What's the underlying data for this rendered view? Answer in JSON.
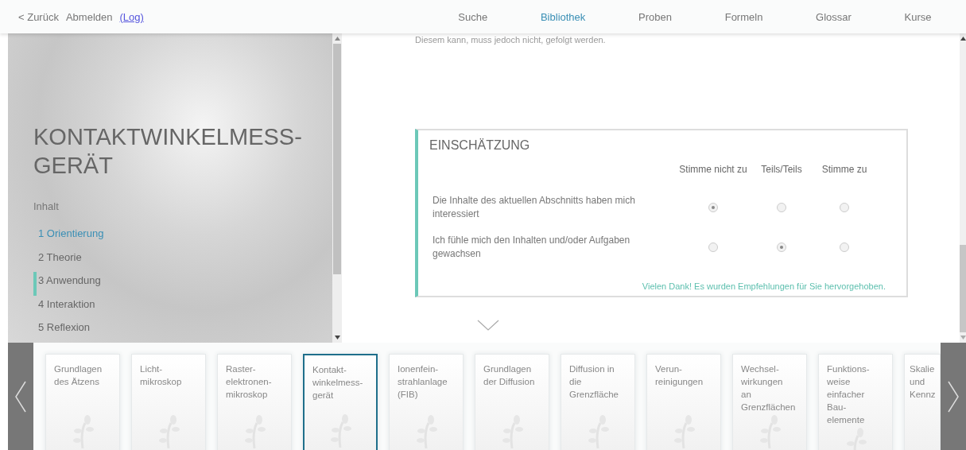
{
  "header": {
    "back": "< Zurück",
    "logout": "Abmelden",
    "log_link": "(Log)",
    "nav": [
      {
        "label": "Suche",
        "selected": false
      },
      {
        "label": "Bibliothek",
        "selected": true
      },
      {
        "label": "Proben",
        "selected": false
      },
      {
        "label": "Formeln",
        "selected": false
      },
      {
        "label": "Glossar",
        "selected": false
      },
      {
        "label": "Kurse",
        "selected": false
      }
    ]
  },
  "sidebar": {
    "title": "KONTAKTWINKELMESS-GERÄT",
    "contents_label": "Inhalt",
    "items": [
      {
        "label": "1 Orientierung",
        "selected": true,
        "marked": false
      },
      {
        "label": "2 Theorie",
        "selected": false,
        "marked": false
      },
      {
        "label": "3 Anwendung",
        "selected": false,
        "marked": true
      },
      {
        "label": "4 Interaktion",
        "selected": false,
        "marked": false
      },
      {
        "label": "5 Reflexion",
        "selected": false,
        "marked": false
      }
    ]
  },
  "content": {
    "intro_text": "Diesem kann, muss jedoch nicht, gefolgt werden.",
    "survey": {
      "title": "EINSCHÄTZUNG",
      "columns": [
        "Stimme nicht zu",
        "Teils/Teils",
        "Stimme zu"
      ],
      "rows": [
        {
          "statement": "Die Inhalte des aktuellen Abschnitts haben mich interessiert",
          "options": [
            {
              "selected": true
            },
            {
              "selected": false
            },
            {
              "selected": false
            }
          ]
        },
        {
          "statement": "Ich fühle mich den Inhalten und/oder Aufgaben gewachsen",
          "options": [
            {
              "selected": false
            },
            {
              "selected": true
            },
            {
              "selected": false
            }
          ]
        }
      ],
      "thanks": "Vielen Dank! Es wurden Empfehlungen für Sie hervorgehoben."
    }
  },
  "carousel": {
    "cards": [
      {
        "lines": [
          "Grundlagen",
          "des Ätzens"
        ],
        "selected": false
      },
      {
        "lines": [
          "Licht-",
          "mikroskop"
        ],
        "selected": false
      },
      {
        "lines": [
          "Raster-",
          "elektronen-",
          "mikroskop"
        ],
        "selected": false
      },
      {
        "lines": [
          "Kontakt-",
          "winkelmess-",
          "gerät"
        ],
        "selected": true
      },
      {
        "lines": [
          "Ionenfein-",
          "strahlanlage",
          "(FIB)"
        ],
        "selected": false
      },
      {
        "lines": [
          "Grundlagen",
          "der Diffusion"
        ],
        "selected": false
      },
      {
        "lines": [
          "Diffusion in",
          "die",
          "Grenzfläche"
        ],
        "selected": false
      },
      {
        "lines": [
          "Verun-",
          "reinigungen"
        ],
        "selected": false
      },
      {
        "lines": [
          "Wechsel-",
          "wirkungen",
          "an",
          "Grenzflächen"
        ],
        "selected": false
      },
      {
        "lines": [
          "Funktions-",
          "weise",
          "einfacher",
          "Bau-",
          "elemente"
        ],
        "selected": false
      },
      {
        "lines": [
          "Skalie",
          "und",
          "Kennz"
        ],
        "selected": false
      }
    ]
  }
}
